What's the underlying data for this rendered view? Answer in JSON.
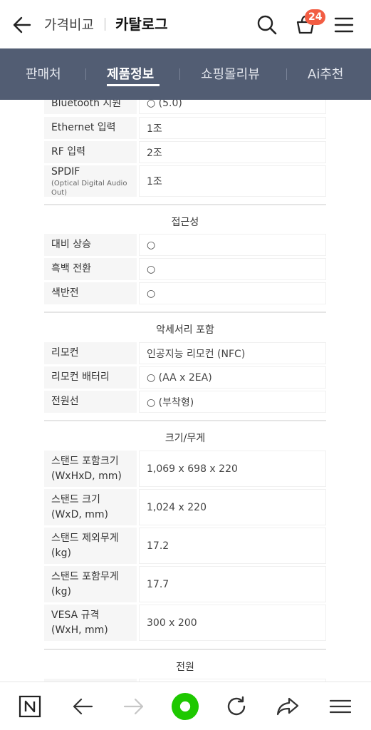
{
  "header": {
    "crumb_parent": "가격비교",
    "crumb_current": "카탈로그",
    "cart_count": "24",
    "icons": [
      "back-arrow-icon",
      "search-icon",
      "cart-icon",
      "hamburger-menu-icon"
    ]
  },
  "tabs": [
    {
      "label": "판매처",
      "active": false
    },
    {
      "label": "제품정보",
      "active": true
    },
    {
      "label": "쇼핑몰리뷰",
      "active": false
    },
    {
      "label": "Ai추천",
      "active": false
    }
  ],
  "spec_connectivity": {
    "rows": [
      {
        "key": "Bluetooth 지원",
        "value": "○ (5.0)"
      },
      {
        "key": "Ethernet 입력",
        "value": "1조"
      },
      {
        "key": "RF 입력",
        "value": "2조"
      },
      {
        "key": "SPDIF",
        "sub": "(Optical Digital Audio Out)",
        "value": "1조"
      }
    ]
  },
  "spec_accessibility": {
    "title": "접근성",
    "rows": [
      {
        "key": "대비 상승",
        "value": "○"
      },
      {
        "key": "흑백 전환",
        "value": "○"
      },
      {
        "key": "색반전",
        "value": "○"
      }
    ]
  },
  "spec_accessories": {
    "title": "악세서리 포함",
    "rows": [
      {
        "key": "리모컨",
        "value": "인공지능 리모컨 (NFC)"
      },
      {
        "key": "리모컨 배터리",
        "value": "○ (AA x 2EA)"
      },
      {
        "key": "전원선",
        "value": "○ (부착형)"
      }
    ]
  },
  "spec_size": {
    "title": "크기/무게",
    "rows": [
      {
        "key": "스탠드 포함크기",
        "sub2": "(WxHxD, mm)",
        "value": "1,069 x 698 x 220"
      },
      {
        "key": "스탠드 크기",
        "sub2": "(WxD, mm)",
        "value": "1,024 x 220"
      },
      {
        "key": "스탠드 제외무게",
        "sub2": "(kg)",
        "value": "17.2"
      },
      {
        "key": "스탠드 포함무게",
        "sub2": "(kg)",
        "value": "17.7"
      },
      {
        "key": "VESA 규격",
        "sub2": "(WxH, mm)",
        "value": "300 x 200"
      }
    ]
  },
  "spec_power": {
    "title": "전원"
  },
  "bottom_nav": {
    "icons": [
      "naver-n-icon",
      "back-icon",
      "forward-icon",
      "home-dot-icon",
      "refresh-icon",
      "share-icon",
      "menu-icon"
    ],
    "accent": "#1ec800"
  },
  "colors": {
    "tabbar_bg": "#525d73",
    "badge": "#f25d43"
  }
}
